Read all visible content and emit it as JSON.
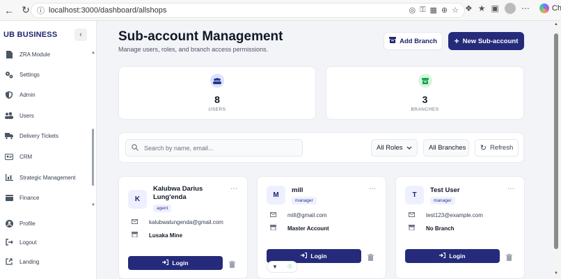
{
  "browser": {
    "url": "localhost:3000/dashboard/allshops",
    "chat_label": "Chat"
  },
  "sidebar": {
    "brand": "UB BUSINESS",
    "items": [
      {
        "label": "ZRA Module",
        "icon": "document-icon"
      },
      {
        "label": "Settings",
        "icon": "gears-icon"
      },
      {
        "label": "Admin",
        "icon": "shield-icon"
      },
      {
        "label": "Users",
        "icon": "users-icon"
      },
      {
        "label": "Delivery Tickets",
        "icon": "truck-icon"
      },
      {
        "label": "CRM",
        "icon": "id-card-icon"
      },
      {
        "label": "Strategic Management",
        "icon": "chart-icon"
      },
      {
        "label": "Finance",
        "icon": "wallet-icon"
      }
    ],
    "bottom_items": [
      {
        "label": "Profile",
        "icon": "user-circle-icon"
      },
      {
        "label": "Logout",
        "icon": "logout-icon"
      },
      {
        "label": "Landing",
        "icon": "external-link-icon"
      }
    ]
  },
  "header": {
    "title": "Sub-account Management",
    "subtitle": "Manage users, roles, and branch access permissions.",
    "add_branch_label": "Add Branch",
    "new_sub_label": "New Sub-account"
  },
  "stats": {
    "users": {
      "value": "8",
      "label": "USERS",
      "color": "#dbe3ff"
    },
    "branches": {
      "value": "3",
      "label": "BRANCHES",
      "color": "#d7f5e2"
    }
  },
  "filters": {
    "search_placeholder": "Search by name, email...",
    "roles_label": "All Roles",
    "branches_label": "All Branches",
    "refresh_label": "Refresh"
  },
  "cards": [
    {
      "initial": "K",
      "name": "Kalubwa Darius Lung'enda",
      "role": "agent",
      "email": "kalubwalungenda@gmail.com",
      "branch": "Lusaka Mine",
      "login_label": "Login"
    },
    {
      "initial": "M",
      "name": "mill",
      "role": "manager",
      "email": "mill@gmail.com",
      "branch": "Master Account",
      "login_label": "Login"
    },
    {
      "initial": "T",
      "name": "Test User",
      "role": "manager",
      "email": "test123@example.com",
      "branch": "No Branch",
      "login_label": "Login"
    }
  ],
  "colors": {
    "brand": "#252b7a",
    "accent_bg": "#eef0ff"
  }
}
